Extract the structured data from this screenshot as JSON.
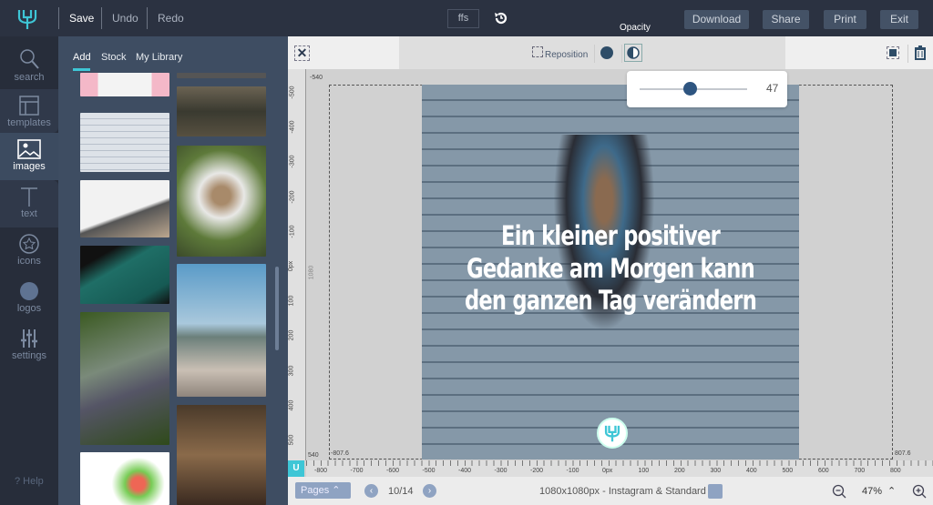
{
  "topbar": {
    "save": "Save",
    "undo": "Undo",
    "redo": "Redo",
    "font_badge": "ffs",
    "download": "Download",
    "share": "Share",
    "print": "Print",
    "exit": "Exit",
    "brand_color": "#3ec6d6"
  },
  "rail": {
    "items": [
      {
        "label": "search",
        "icon": "search-icon"
      },
      {
        "label": "templates",
        "icon": "layout-icon"
      },
      {
        "label": "images",
        "icon": "image-icon",
        "selected": true
      },
      {
        "label": "text",
        "icon": "text-icon"
      },
      {
        "label": "icons",
        "icon": "star-icon"
      },
      {
        "label": "logos",
        "icon": "badge-icon"
      },
      {
        "label": "settings",
        "icon": "sliders-icon"
      }
    ],
    "help": "? Help"
  },
  "panel": {
    "tabs": [
      "Add",
      "Stock",
      "My Library"
    ],
    "active_tab": "Add"
  },
  "toolbar": {
    "reposition": "Reposition",
    "tooltip": "Opacity",
    "opacity_value": "47",
    "opacity_percent": 47
  },
  "canvas": {
    "quote_lines": [
      "Ein kleiner positiver",
      "Gedanke am Morgen kann",
      "den ganzen Tag verändern"
    ],
    "corner_top": "-540",
    "corner_bottom": "540",
    "left_edge": "-807.6",
    "right_edge": "807.6",
    "vertical_side": "1080",
    "ruler_h": [
      "-800",
      "-700",
      "-600",
      "-500",
      "-400",
      "-300",
      "-200",
      "-100",
      "0px",
      "100",
      "200",
      "300",
      "400",
      "500",
      "600",
      "700",
      "800"
    ],
    "ruler_v": [
      "-500",
      "-400",
      "-300",
      "-200",
      "-100",
      "0px",
      "100",
      "200",
      "300",
      "400",
      "500"
    ]
  },
  "bottombar": {
    "pages": "Pages",
    "page_indicator": "10/14",
    "size_label": "1080x1080px - Instagram & Standard",
    "zoom": "47%"
  }
}
